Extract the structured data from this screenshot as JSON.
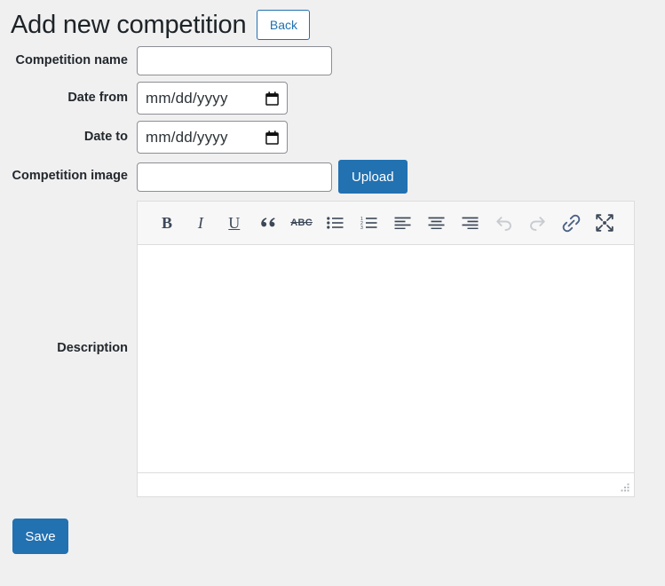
{
  "header": {
    "title": "Add new competition",
    "back_label": "Back"
  },
  "form": {
    "fields": [
      {
        "label": "Competition name",
        "type": "text",
        "value": "",
        "placeholder": ""
      },
      {
        "label": "Date from",
        "type": "date",
        "value": "",
        "placeholder": "mm/dd/yyyy"
      },
      {
        "label": "Date to",
        "type": "date",
        "value": "",
        "placeholder": "mm/dd/yyyy"
      },
      {
        "label": "Competition image",
        "type": "file-text",
        "value": "",
        "placeholder": "",
        "button_label": "Upload"
      }
    ],
    "description_label": "Description"
  },
  "editor": {
    "content": "",
    "toolbar": [
      {
        "name": "bold-icon",
        "label": "B",
        "title": "Bold",
        "disabled": false
      },
      {
        "name": "italic-icon",
        "label": "I",
        "title": "Italic",
        "disabled": false
      },
      {
        "name": "underline-icon",
        "label": "U",
        "title": "Underline",
        "disabled": false
      },
      {
        "name": "blockquote-icon",
        "label": "“",
        "title": "Blockquote",
        "disabled": false
      },
      {
        "name": "strikethrough-icon",
        "label": "ABC",
        "title": "Strikethrough",
        "disabled": false
      },
      {
        "name": "unordered-list-icon",
        "label": "",
        "title": "Bulleted list",
        "disabled": false
      },
      {
        "name": "ordered-list-icon",
        "label": "",
        "title": "Numbered list",
        "disabled": false
      },
      {
        "name": "align-left-icon",
        "label": "",
        "title": "Align left",
        "disabled": false
      },
      {
        "name": "align-center-icon",
        "label": "",
        "title": "Align center",
        "disabled": false
      },
      {
        "name": "align-right-icon",
        "label": "",
        "title": "Align right",
        "disabled": false
      },
      {
        "name": "undo-icon",
        "label": "",
        "title": "Undo",
        "disabled": true
      },
      {
        "name": "redo-icon",
        "label": "",
        "title": "Redo",
        "disabled": true
      },
      {
        "name": "link-icon",
        "label": "",
        "title": "Insert link",
        "disabled": false
      },
      {
        "name": "fullscreen-icon",
        "label": "",
        "title": "Fullscreen",
        "disabled": false
      }
    ]
  },
  "footer": {
    "save_label": "Save"
  },
  "colors": {
    "page_background": "#f0f0f1",
    "accent_blue": "#2271b1",
    "text_dark": "#1d2327",
    "input_border": "#8c8f94",
    "toolbar_background": "#f7f7f7",
    "toolbar_icon": "#3c4858",
    "toolbar_icon_disabled": "#c8ccd1",
    "link_icon": "#4a6285"
  }
}
